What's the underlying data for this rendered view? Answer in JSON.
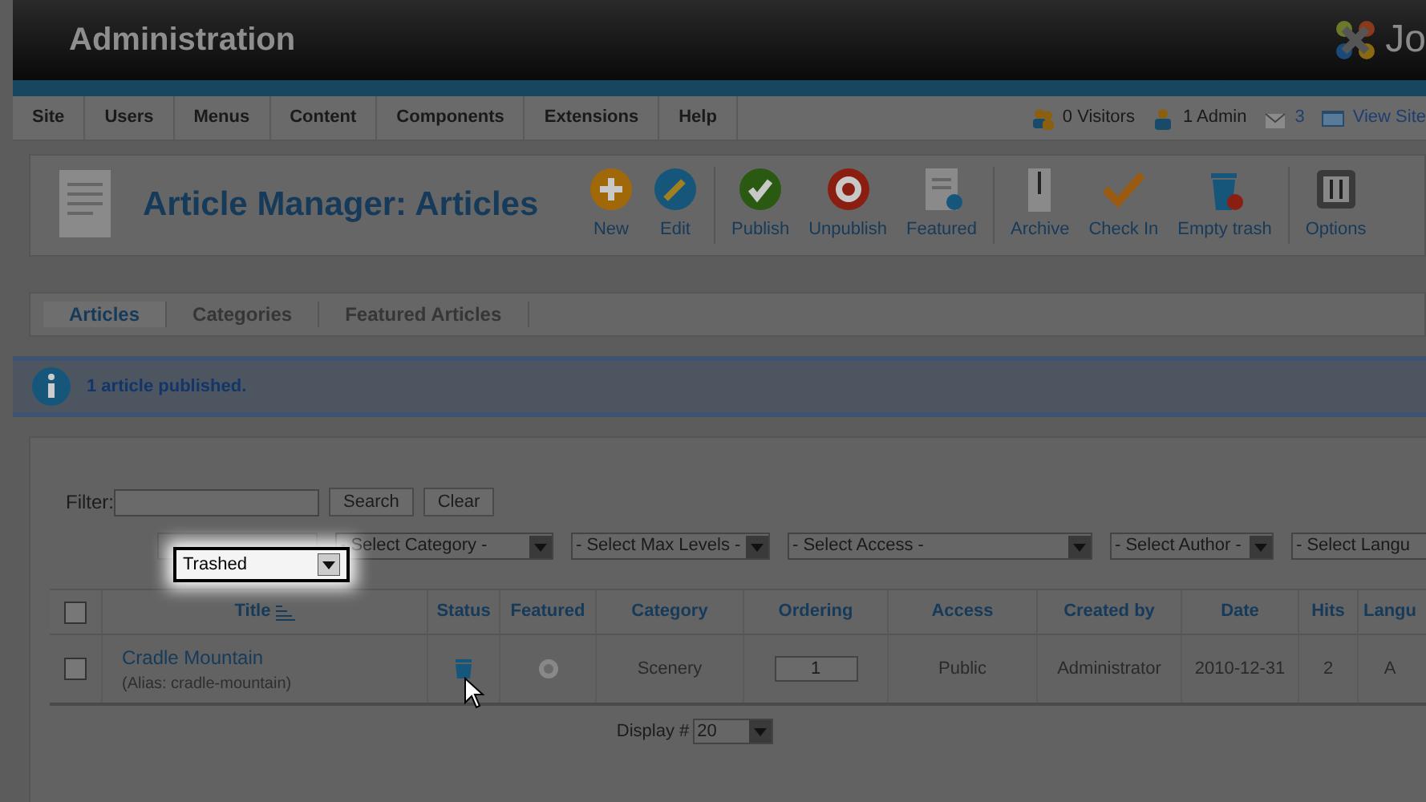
{
  "header": {
    "title": "Administration",
    "logo_text": "Jo"
  },
  "menu": [
    "Site",
    "Users",
    "Menus",
    "Content",
    "Components",
    "Extensions",
    "Help"
  ],
  "status_items": [
    {
      "kind": "visitors",
      "label": "0 Visitors"
    },
    {
      "kind": "admin",
      "label": "1 Admin"
    },
    {
      "kind": "messages",
      "label": "3"
    },
    {
      "kind": "view_site",
      "label": "View Site"
    }
  ],
  "page_title": "Article Manager: Articles",
  "toolbar": [
    {
      "kind": "new",
      "label": "New"
    },
    {
      "kind": "edit",
      "label": "Edit"
    },
    {
      "kind": "separator"
    },
    {
      "kind": "publish",
      "label": "Publish"
    },
    {
      "kind": "unpublish",
      "label": "Unpublish"
    },
    {
      "kind": "featured",
      "label": "Featured"
    },
    {
      "kind": "separator"
    },
    {
      "kind": "archive",
      "label": "Archive"
    },
    {
      "kind": "checkin",
      "label": "Check In"
    },
    {
      "kind": "trash",
      "label": "Empty trash"
    },
    {
      "kind": "separator"
    },
    {
      "kind": "options",
      "label": "Options"
    }
  ],
  "tabs": [
    {
      "label": "Articles",
      "selected": true
    },
    {
      "label": "Categories",
      "selected": false
    },
    {
      "label": "Featured Articles",
      "selected": false
    }
  ],
  "message": "1 article published.",
  "filter": {
    "label": "Filter:",
    "search_button": "Search",
    "clear_button": "Clear"
  },
  "selects": [
    {
      "value": "Trashed",
      "highlighted": true
    },
    {
      "value": "- Select Category -",
      "highlighted": false
    },
    {
      "value": "- Select Max Levels -",
      "highlighted": false
    },
    {
      "value": "- Select Access -",
      "highlighted": false
    },
    {
      "value": "- Select Author -",
      "highlighted": false
    },
    {
      "value": "- Select Langu",
      "highlighted": false
    }
  ],
  "table": {
    "columns": [
      "Title",
      "Status",
      "Featured",
      "Category",
      "Ordering",
      "Access",
      "Created by",
      "Date",
      "Hits",
      "Langu"
    ],
    "select_all": {
      "checked": false
    },
    "rows": [
      {
        "checked": false,
        "title": "Cradle Mountain",
        "alias": "(Alias: cradle-mountain)",
        "trashed": true,
        "featured": false,
        "category": "Scenery",
        "ordering": "1",
        "access": "Public",
        "created_by": "Administrator",
        "date": "2010-12-31",
        "hits": "2",
        "language": "A"
      }
    ]
  },
  "pagination": {
    "label": "Display #",
    "value": "20"
  }
}
